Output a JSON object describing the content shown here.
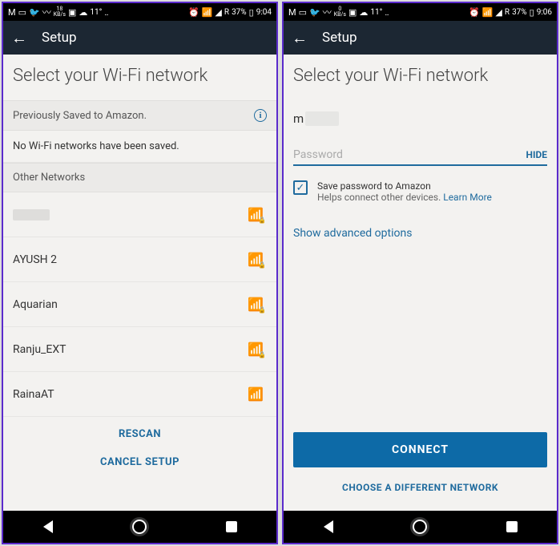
{
  "screen1": {
    "status": {
      "kb": "18",
      "kb_unit": "KB/s",
      "temp": "11°",
      "battery": "37%",
      "time": "9:04",
      "r": "R"
    },
    "header": {
      "title": "Setup"
    },
    "page_title": "Select your Wi-Fi network",
    "saved_header": "Previously Saved to Amazon.",
    "no_saved": "No Wi-Fi networks have been saved.",
    "other_header": "Other Networks",
    "networks": [
      {
        "name": ""
      },
      {
        "name": "AYUSH 2"
      },
      {
        "name": "Aquarian"
      },
      {
        "name": "Ranju_EXT"
      },
      {
        "name": "RainaAT"
      }
    ],
    "rescan": "RESCAN",
    "cancel": "CANCEL SETUP"
  },
  "screen2": {
    "status": {
      "kb": "0",
      "kb_unit": "KB/s",
      "temp": "11°",
      "battery": "37%",
      "time": "9:06",
      "r": "R"
    },
    "header": {
      "title": "Setup"
    },
    "page_title": "Select your Wi-Fi network",
    "network_prefix": "m",
    "password_placeholder": "Password",
    "hide": "HIDE",
    "save_pw": "Save password to Amazon",
    "save_pw_sub": "Helps connect other devices.",
    "learn_more": "Learn More",
    "advanced": "Show advanced options",
    "connect": "CONNECT",
    "choose_diff": "CHOOSE A DIFFERENT NETWORK"
  }
}
